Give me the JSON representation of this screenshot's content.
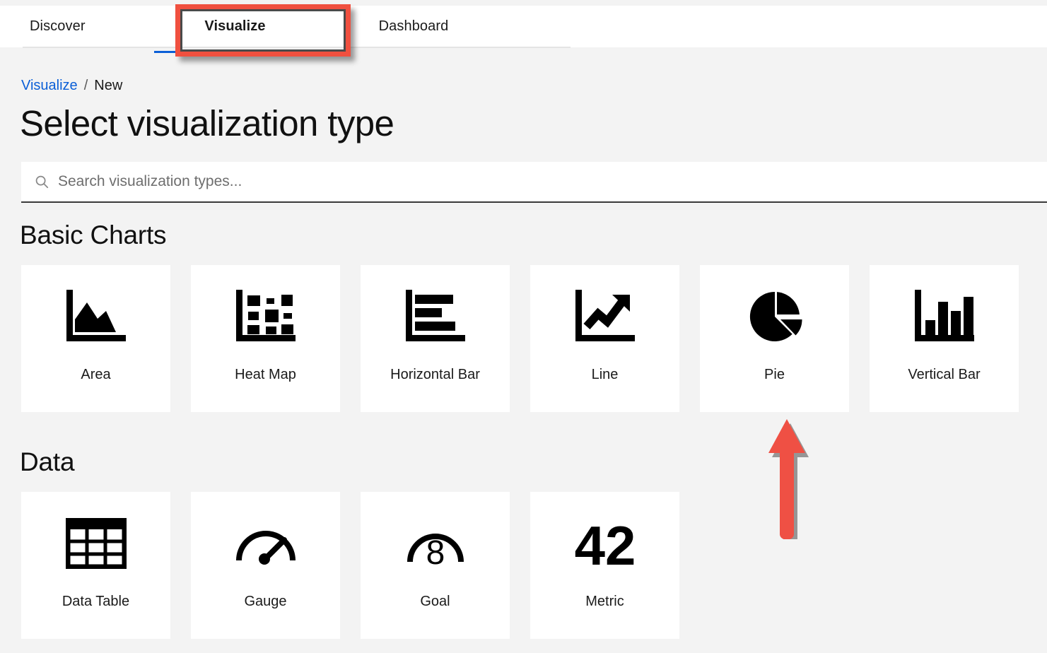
{
  "nav": {
    "tabs": [
      {
        "label": "Discover",
        "active": false
      },
      {
        "label": "Visualize",
        "active": true
      },
      {
        "label": "Dashboard",
        "active": false
      }
    ],
    "active_underline_color": "#0b5fd7"
  },
  "breadcrumb": {
    "root_label": "Visualize",
    "separator": "/",
    "current_label": "New",
    "link_color": "#0b5fd7"
  },
  "page": {
    "title": "Select visualization type"
  },
  "search": {
    "placeholder": "Search visualization types...",
    "value": "",
    "icon": "search-icon"
  },
  "sections": [
    {
      "title": "Basic Charts",
      "cards": [
        {
          "label": "Area",
          "icon": "area-chart-icon"
        },
        {
          "label": "Heat Map",
          "icon": "heat-map-icon"
        },
        {
          "label": "Horizontal Bar",
          "icon": "horizontal-bar-chart-icon"
        },
        {
          "label": "Line",
          "icon": "line-chart-icon"
        },
        {
          "label": "Pie",
          "icon": "pie-chart-icon"
        },
        {
          "label": "Vertical Bar",
          "icon": "vertical-bar-chart-icon"
        }
      ]
    },
    {
      "title": "Data",
      "cards": [
        {
          "label": "Data Table",
          "icon": "data-table-icon"
        },
        {
          "label": "Gauge",
          "icon": "gauge-icon"
        },
        {
          "label": "Goal",
          "icon": "goal-icon",
          "icon_value": "8"
        },
        {
          "label": "Metric",
          "icon": "metric-icon",
          "icon_value": "42"
        }
      ]
    }
  ],
  "annotations": {
    "highlight_box": {
      "target": "Visualize",
      "border_color": "#f0503f",
      "inner_border_color": "#4a4a4a"
    },
    "arrow": {
      "target": "Pie",
      "direction": "up",
      "color": "#ef5044"
    }
  }
}
